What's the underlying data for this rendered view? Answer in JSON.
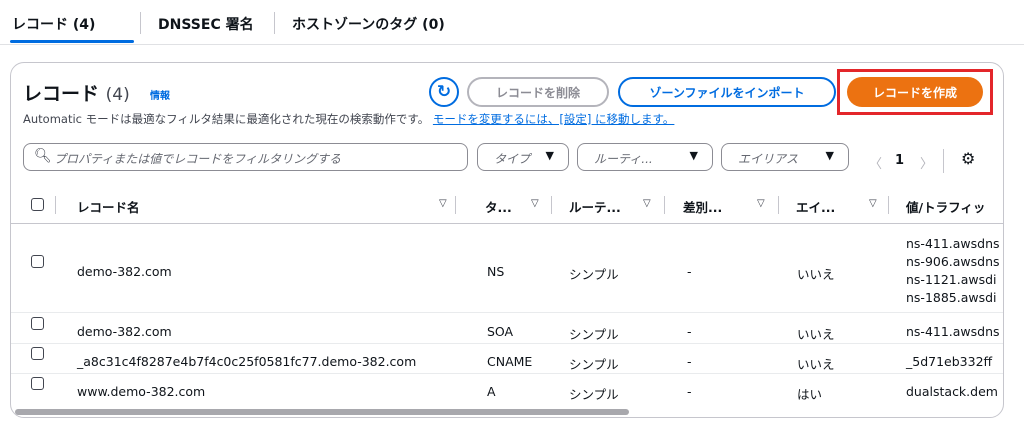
{
  "tabs": [
    {
      "label": "レコード (4)"
    },
    {
      "label": "DNSSEC 署名"
    },
    {
      "label": "ホストゾーンのタグ (0)"
    }
  ],
  "panel": {
    "title": "レコード",
    "count": "(4)",
    "info": "情報",
    "subtitle_text": "Automatic モードは最適なフィルタ結果に最適化された現在の検索動作です。",
    "subtitle_link": "モードを変更するには、[設定] に移動します。",
    "refresh_icon": "refresh-icon",
    "delete_label": "レコードを削除",
    "import_label": "ゾーンファイルをインポート",
    "create_label": "レコードを作成"
  },
  "filters": {
    "search_placeholder": "プロパティまたは値でレコードをフィルタリングする",
    "type_label": "タイプ",
    "routing_label": "ルーティ...",
    "alias_label": "エイリアス"
  },
  "pagination": {
    "prev": "〈",
    "page": "1",
    "next": "〉"
  },
  "columns": [
    "レコード名",
    "タ...",
    "ルーテ...",
    "差別...",
    "エイ...",
    "値/トラフィッ"
  ],
  "rows": [
    {
      "name": "demo-382.com",
      "type": "NS",
      "routing": "シンプル",
      "diff": "-",
      "alias": "いいえ",
      "values": [
        "ns-411.awsdns",
        "ns-906.awsdns",
        "ns-1121.awsdi",
        "ns-1885.awsdi"
      ]
    },
    {
      "name": "demo-382.com",
      "type": "SOA",
      "routing": "シンプル",
      "diff": "-",
      "alias": "いいえ",
      "values": [
        "ns-411.awsdns"
      ]
    },
    {
      "name": "_a8c31c4f8287e4b7f4c0c25f0581fc77.demo-382.com",
      "type": "CNAME",
      "routing": "シンプル",
      "diff": "-",
      "alias": "いいえ",
      "values": [
        "_5d71eb332ff"
      ]
    },
    {
      "name": "www.demo-382.com",
      "type": "A",
      "routing": "シンプル",
      "diff": "-",
      "alias": "はい",
      "values": [
        "dualstack.dem"
      ]
    }
  ],
  "colors": {
    "accent": "#006ce0",
    "primary_button": "#ec7211",
    "highlight": "#e3262a"
  }
}
